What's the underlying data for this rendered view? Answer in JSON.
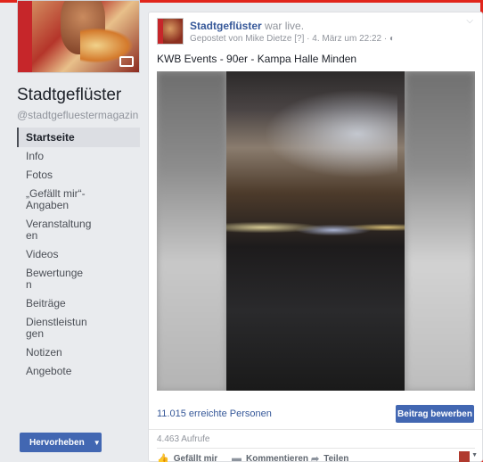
{
  "page": {
    "name": "Stadtgeflüster",
    "handle": "@stadtgefluestermagazin"
  },
  "nav": {
    "items": [
      {
        "label": "Startseite",
        "active": true
      },
      {
        "label": "Info"
      },
      {
        "label": "Fotos"
      },
      {
        "label": "„Gefällt mir“-Angaben"
      },
      {
        "label": "Veranstaltungen"
      },
      {
        "label": "Videos"
      },
      {
        "label": "Bewertungen"
      },
      {
        "label": "Beiträge"
      },
      {
        "label": "Dienstleistungen"
      },
      {
        "label": "Notizen"
      },
      {
        "label": "Angebote"
      }
    ],
    "promote_label": "Hervorheben",
    "promote_caret": "▼"
  },
  "post": {
    "author": "Stadtgeflüster",
    "action": " war live.",
    "meta": "Gepostet von Mike Dietze [?] · 4. März um 22:22 · ◐",
    "text": "KWB Events - 90er - Kampa Halle Minden",
    "options": "⌵",
    "reach": "11.015 erreichte Personen",
    "boost_label": "Beitrag bewerben",
    "views": "4.463 Aufrufe",
    "actions": {
      "like": "Gefällt mir",
      "comment": "Kommentieren",
      "share": "Teilen"
    },
    "icons": {
      "like": "thumbs-up-icon",
      "comment": "comment-icon",
      "share": "share-arrow-icon"
    }
  },
  "colors": {
    "brand_blue": "#4267b2",
    "link_blue": "#365899",
    "frame_red": "#e1251b",
    "background": "#e9ebee"
  }
}
